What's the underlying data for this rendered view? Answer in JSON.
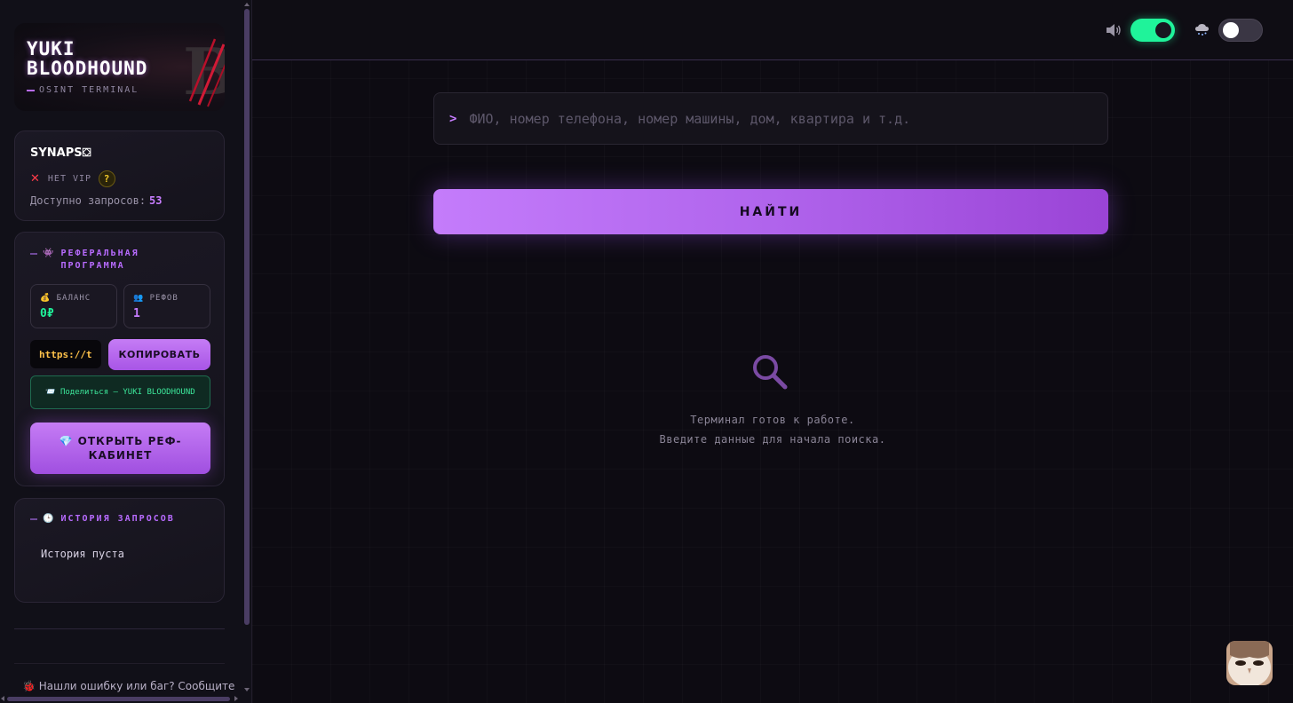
{
  "sidebar": {
    "logo": {
      "title_line1": "YUKI",
      "title_line2": "BLOODHOUND",
      "subtitle": "OSINT TERMINAL"
    },
    "user": {
      "name": "SYNAPS⛋",
      "vip_status": "НЕТ VIP",
      "help_label": "?",
      "requests_label": "Доступно запросов:",
      "requests_count": "53"
    },
    "referral": {
      "title": "РЕФЕРАЛЬНАЯ ПРОГРАММА",
      "title_icon": "👾",
      "balance_label": "БАЛАНС",
      "balance_icon": "💰",
      "balance_value": "0₽",
      "refs_label": "РЕФОВ",
      "refs_icon": "👥",
      "refs_value": "1",
      "link_value": "https://t",
      "copy_label": "КОПИРОВАТЬ",
      "share_icon": "📨",
      "share_label": "Поделиться — YUKI BLOODHOUND",
      "open_icon": "💎",
      "open_label": "ОТКРЫТЬ РЕФ-КАБИНЕТ"
    },
    "history": {
      "icon": "🕒",
      "title": "ИСТОРИЯ ЗАПРОСОВ",
      "empty_text": "История пуста"
    },
    "bug_report": {
      "icon": "🐞",
      "text": "Нашли ошибку или баг? Сообщите"
    }
  },
  "topbar": {
    "sound_toggle_on": true,
    "weather_toggle_on": false
  },
  "search": {
    "prompt": ">",
    "placeholder": "ФИО, номер телефона, номер машины, дом, квартира и т.д.",
    "value": "",
    "button_label": "НАЙТИ"
  },
  "empty_state": {
    "line1": "Терминал готов к работе.",
    "line2": "Введите данные для начала поиска."
  },
  "colors": {
    "accent": "#c77dff",
    "success": "#1ff39a",
    "link": "#ffc24a",
    "danger": "#ff3b4a",
    "background": "#0d0b12"
  },
  "icons": [
    "sound-icon",
    "weather-icon",
    "search-icon",
    "close-icon",
    "help-icon",
    "gem-icon",
    "clock-icon",
    "bug-icon",
    "bag-icon",
    "people-icon"
  ]
}
